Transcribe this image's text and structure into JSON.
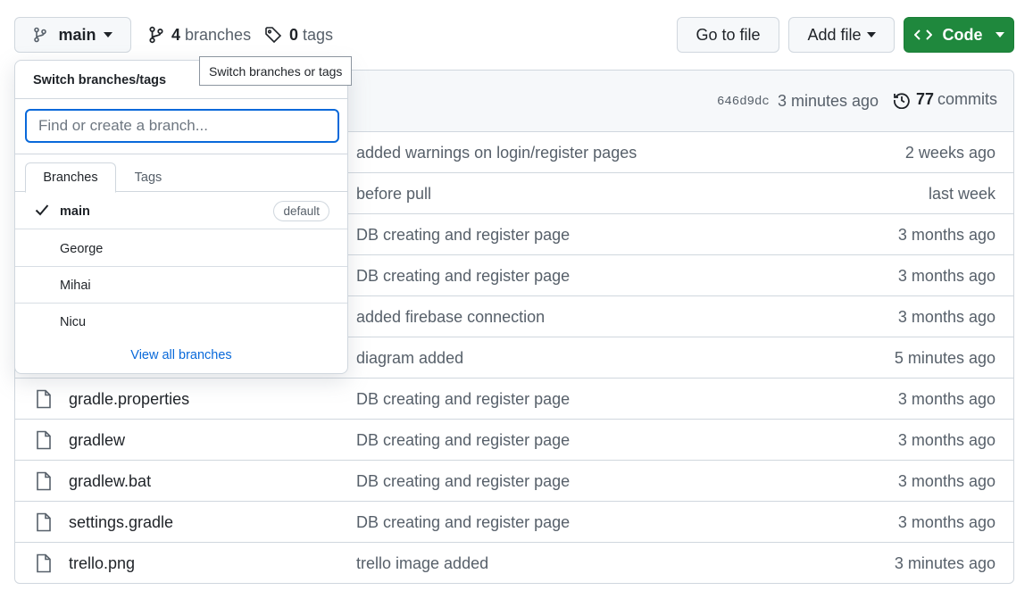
{
  "toolbar": {
    "branch_label": "main",
    "branches_count": "4",
    "branches_label": "branches",
    "tags_count": "0",
    "tags_label": "tags",
    "goto_label": "Go to file",
    "addfile_label": "Add file",
    "code_label": "Code",
    "accent_green": "#1f883d"
  },
  "tooltip": {
    "text": "Switch branches or tags"
  },
  "commit": {
    "sha": "646d9dc",
    "time": "3 minutes ago",
    "commits_count": "77",
    "commits_label": "commits"
  },
  "dropdown": {
    "title": "Switch branches/tags",
    "search_placeholder": "Find or create a branch...",
    "tabs": [
      {
        "label": "Branches"
      },
      {
        "label": "Tags"
      }
    ],
    "branches": [
      {
        "name": "main",
        "badge": "default",
        "selected": true
      },
      {
        "name": "George"
      },
      {
        "name": "Mihai"
      },
      {
        "name": "Nicu"
      }
    ],
    "view_all": "View all branches"
  },
  "files": [
    {
      "name": "",
      "message": "added warnings on login/register pages",
      "age": "2 weeks ago"
    },
    {
      "name": "",
      "message": "before pull",
      "age": "last week"
    },
    {
      "name": "",
      "message": "DB creating and register page",
      "age": "3 months ago"
    },
    {
      "name": "",
      "message": "DB creating and register page",
      "age": "3 months ago"
    },
    {
      "name": "",
      "message": "added firebase connection",
      "age": "3 months ago"
    },
    {
      "name": "",
      "message": "diagram added",
      "age": "5 minutes ago"
    },
    {
      "name": "gradle.properties",
      "message": "DB creating and register page",
      "age": "3 months ago"
    },
    {
      "name": "gradlew",
      "message": "DB creating and register page",
      "age": "3 months ago"
    },
    {
      "name": "gradlew.bat",
      "message": "DB creating and register page",
      "age": "3 months ago"
    },
    {
      "name": "settings.gradle",
      "message": "DB creating and register page",
      "age": "3 months ago"
    },
    {
      "name": "trello.png",
      "message": "trello image added",
      "age": "3 minutes ago"
    }
  ]
}
